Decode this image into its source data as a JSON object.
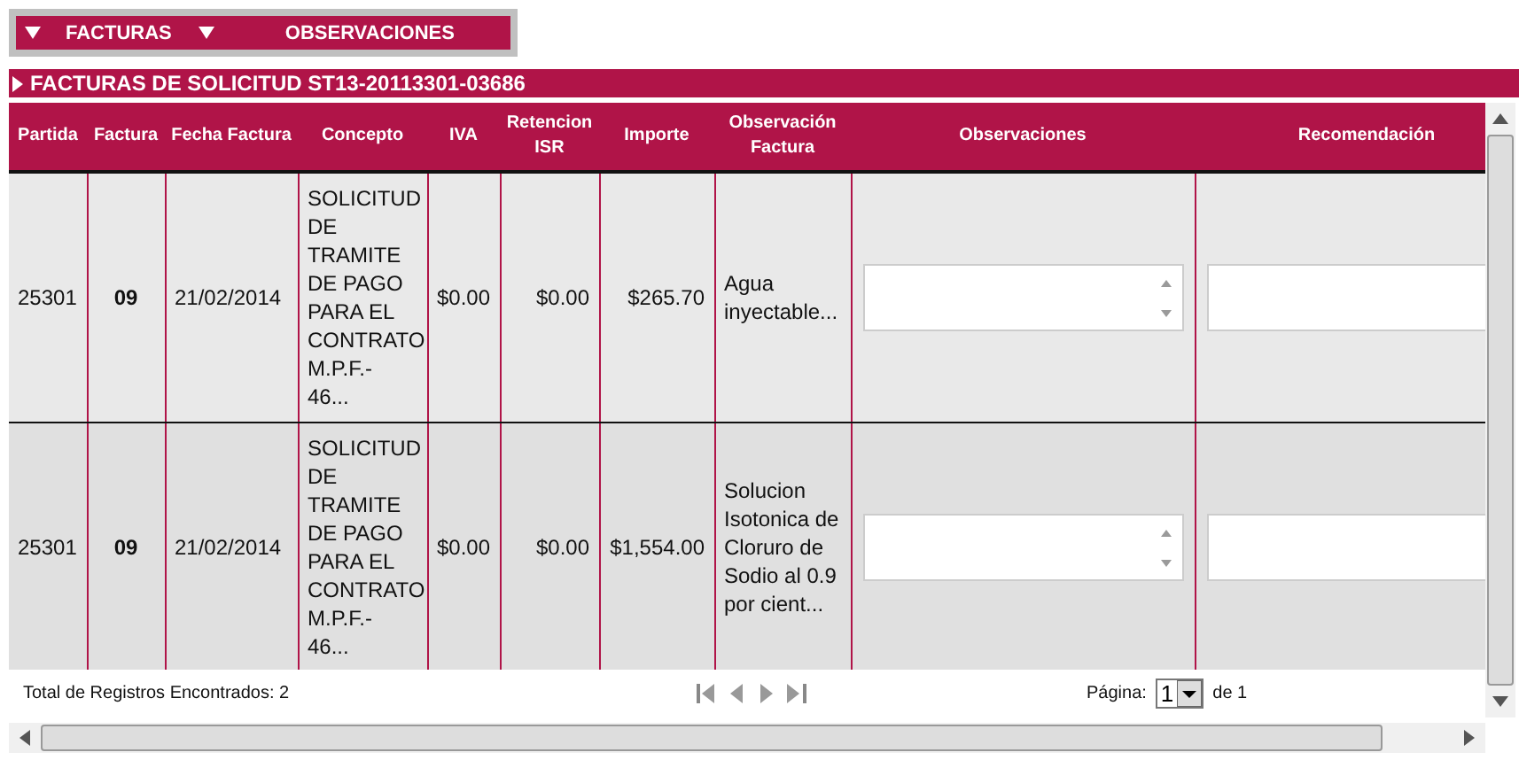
{
  "tabs": [
    {
      "label": "FACTURAS"
    },
    {
      "label": "OBSERVACIONES"
    }
  ],
  "section_title": "FACTURAS DE SOLICITUD ST13-20113301-03686",
  "table": {
    "columns": [
      "Partida",
      "Factura",
      "Fecha Factura",
      "Concepto",
      "IVA",
      "Retencion ISR",
      "Importe",
      "Observación Factura",
      "Observaciones",
      "Recomendación"
    ],
    "rows": [
      {
        "partida": "25301",
        "factura": "09",
        "fecha": "21/02/2014",
        "concepto": "SOLICITUD DE TRAMITE DE PAGO PARA EL CONTRATO M.P.F.- 46...",
        "iva": "$0.00",
        "retencion_isr": "$0.00",
        "importe": "$265.70",
        "observacion_factura": "Agua inyectable..."
      },
      {
        "partida": "25301",
        "factura": "09",
        "fecha": "21/02/2014",
        "concepto": "SOLICITUD DE TRAMITE DE PAGO PARA EL CONTRATO M.P.F.- 46...",
        "iva": "$0.00",
        "retencion_isr": "$0.00",
        "importe": "$1,554.00",
        "observacion_factura": "Solucion Isotonica de Cloruro de Sodio al 0.9 por cient..."
      }
    ]
  },
  "pager": {
    "total": "Total de Registros Encontrados: 2",
    "page_label": "Página:",
    "page_value": "1",
    "page_of": "de 1"
  }
}
